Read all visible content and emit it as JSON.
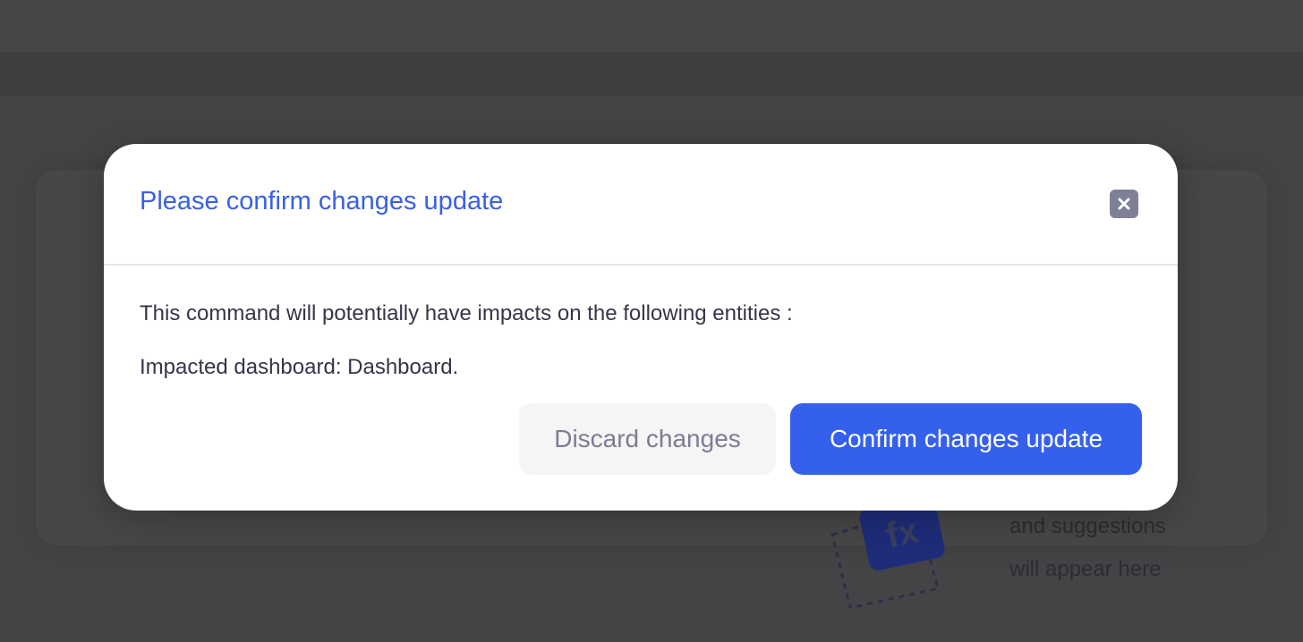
{
  "background": {
    "hint_line_1": "and suggestions",
    "hint_line_2": "will appear here",
    "fx_badge": "fx",
    "fx_icon": "function-icon"
  },
  "modal": {
    "title": "Please confirm changes update",
    "close_icon": "close-icon",
    "message": "This command will potentially have impacts on the following entities :",
    "impact": "Impacted dashboard: Dashboard.",
    "discard_label": "Discard changes",
    "confirm_label": "Confirm changes update"
  },
  "colors": {
    "accent": "#3460ec",
    "title": "#3a60e6",
    "overlay": "#444446"
  }
}
